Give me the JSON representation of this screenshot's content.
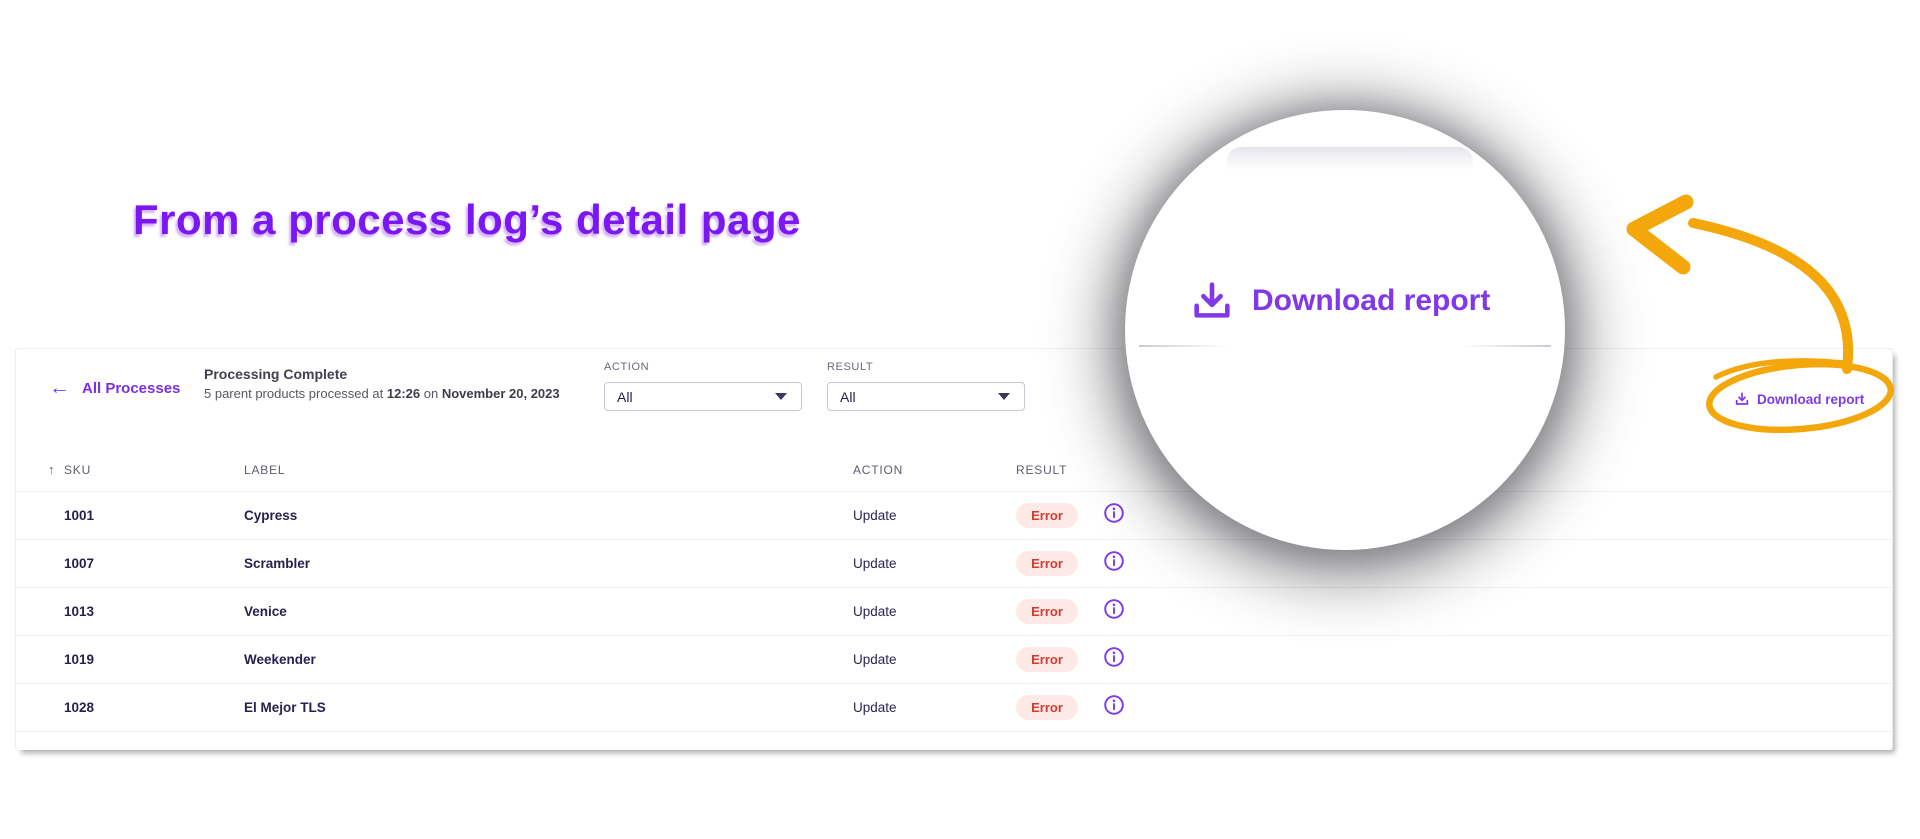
{
  "caption": {
    "text": "From a process log’s detail page"
  },
  "panel": {
    "back_label": "All Processes",
    "status": {
      "title": "Processing Complete",
      "sub_prefix": "5 parent products processed at",
      "time": "12:26",
      "sub_on": "on",
      "date": "November 20, 2023"
    },
    "filters": [
      {
        "label": "ACTION",
        "value": "All"
      },
      {
        "label": "RESULT",
        "value": "All"
      }
    ],
    "download_label": "Download report",
    "table": {
      "headers": {
        "sku": "SKU",
        "label": "LABEL",
        "action": "ACTION",
        "result": "RESULT"
      },
      "rows": [
        {
          "sku": "1001",
          "label": "Cypress",
          "action": "Update",
          "result": "Error"
        },
        {
          "sku": "1007",
          "label": "Scrambler",
          "action": "Update",
          "result": "Error"
        },
        {
          "sku": "1013",
          "label": "Venice",
          "action": "Update",
          "result": "Error"
        },
        {
          "sku": "1019",
          "label": "Weekender",
          "action": "Update",
          "result": "Error"
        },
        {
          "sku": "1028",
          "label": "El Mejor TLS",
          "action": "Update",
          "result": "Error"
        }
      ]
    }
  },
  "magnifier": {
    "label": "Download report"
  },
  "icons": {
    "back": "←",
    "sort_asc": "↑"
  },
  "colors": {
    "purple_link": "#7b2fe3",
    "purple_icon": "#7c3aed",
    "purple_title": "#7a17f2",
    "error_text": "#d03c30",
    "error_bg": "#fdeae7",
    "annotation_yellow": "#f4a70b"
  }
}
